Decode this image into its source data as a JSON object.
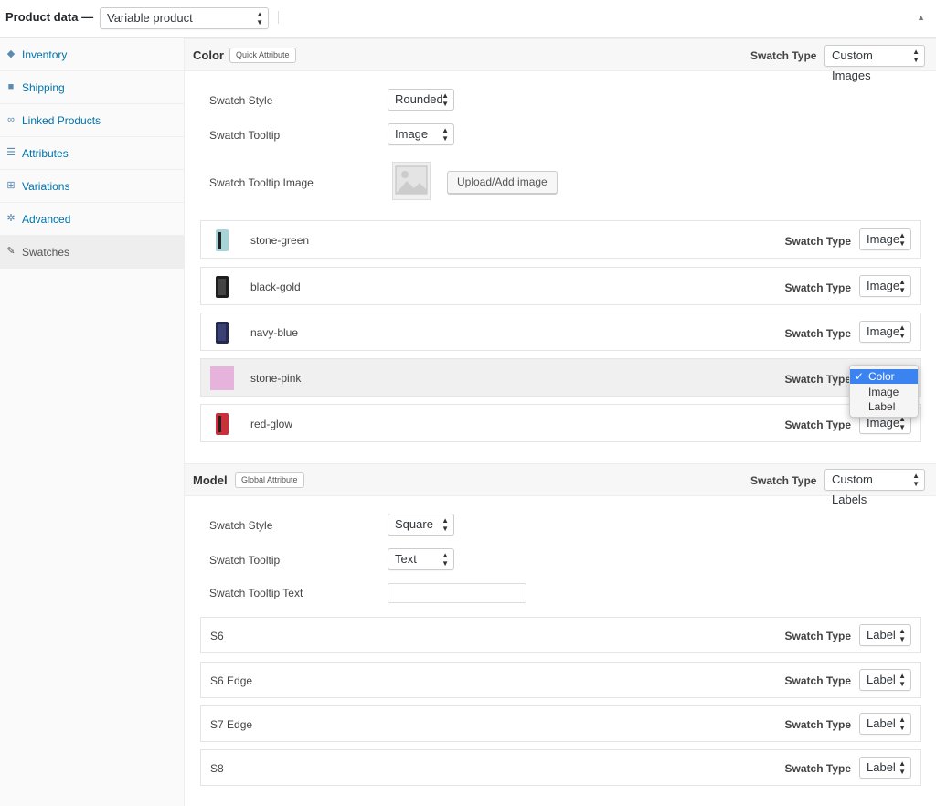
{
  "header": {
    "title": "Product data —",
    "product_type": "Variable product"
  },
  "sidebar": {
    "items": [
      {
        "label": "Inventory",
        "icon": "tag-icon"
      },
      {
        "label": "Shipping",
        "icon": "truck-icon"
      },
      {
        "label": "Linked Products",
        "icon": "link-icon"
      },
      {
        "label": "Attributes",
        "icon": "list-icon"
      },
      {
        "label": "Variations",
        "icon": "grid-icon"
      },
      {
        "label": "Advanced",
        "icon": "gear-icon"
      },
      {
        "label": "Swatches",
        "icon": "wrench-icon"
      }
    ]
  },
  "color_attr": {
    "name": "Color",
    "badge": "Quick Attribute",
    "swatch_type_label": "Swatch Type",
    "swatch_type_value": "Custom Images",
    "style_label": "Swatch Style",
    "style_value": "Rounded",
    "tooltip_label": "Swatch Tooltip",
    "tooltip_value": "Image",
    "tooltip_image_label": "Swatch Tooltip Image",
    "upload_button": "Upload/Add image",
    "terms": [
      {
        "name": "stone-green",
        "st_label": "Swatch Type",
        "st_value": "Image",
        "swatch_color": "#a8d4d8"
      },
      {
        "name": "black-gold",
        "st_label": "Swatch Type",
        "st_value": "Image",
        "swatch_color": "#1e1e1e"
      },
      {
        "name": "navy-blue",
        "st_label": "Swatch Type",
        "st_value": "Image",
        "swatch_color": "#232a4e"
      },
      {
        "name": "stone-pink",
        "st_label": "Swatch Type",
        "st_value": "Color",
        "swatch_color": "#e6b3dc"
      },
      {
        "name": "red-glow",
        "st_label": "Swatch Type",
        "st_value": "Image",
        "swatch_color": "#c8313c"
      }
    ],
    "dropdown_options": [
      "Color",
      "Image",
      "Label"
    ],
    "dropdown_selected": "Color"
  },
  "model_attr": {
    "name": "Model",
    "badge": "Global Attribute",
    "swatch_type_label": "Swatch Type",
    "swatch_type_value": "Custom Labels",
    "style_label": "Swatch Style",
    "style_value": "Square",
    "tooltip_label": "Swatch Tooltip",
    "tooltip_value": "Text",
    "tooltip_text_label": "Swatch Tooltip Text",
    "tooltip_text_value": "",
    "terms": [
      {
        "name": "S6",
        "st_label": "Swatch Type",
        "st_value": "Label"
      },
      {
        "name": "S6 Edge",
        "st_label": "Swatch Type",
        "st_value": "Label"
      },
      {
        "name": "S7 Edge",
        "st_label": "Swatch Type",
        "st_value": "Label"
      },
      {
        "name": "S8",
        "st_label": "Swatch Type",
        "st_value": "Label"
      }
    ]
  },
  "colors": {
    "link": "#0073aa",
    "dropdown_highlight": "#3a83f1"
  }
}
